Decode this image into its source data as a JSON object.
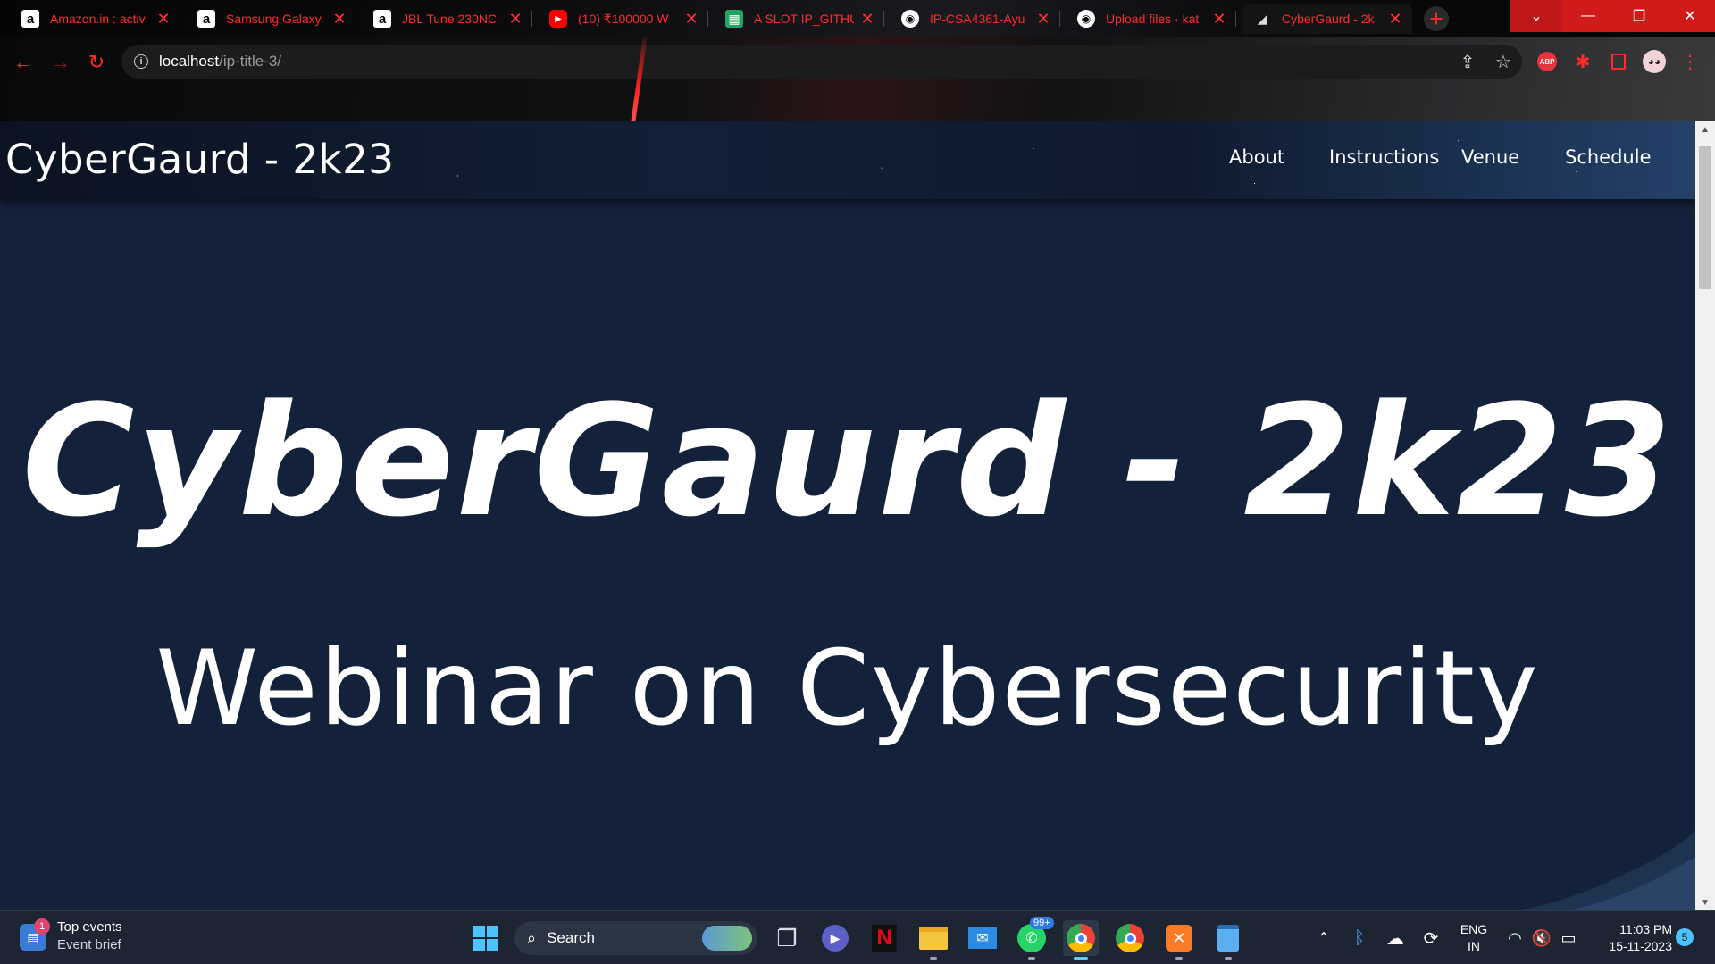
{
  "browser": {
    "tabs": [
      {
        "title": "Amazon.in : activ",
        "favicon": "amazon-icon"
      },
      {
        "title": "Samsung Galaxy",
        "favicon": "amazon-icon"
      },
      {
        "title": "JBL Tune 230NC",
        "favicon": "amazon-icon"
      },
      {
        "title": "(10) ₹100000 W",
        "favicon": "youtube-icon"
      },
      {
        "title": "A SLOT IP_GITHU",
        "favicon": "sheets-icon"
      },
      {
        "title": "IP-CSA4361-Ayu",
        "favicon": "github-icon"
      },
      {
        "title": "Upload files · kat",
        "favicon": "github-icon"
      },
      {
        "title": "CyberGaurd - 2k",
        "favicon": "site-icon"
      }
    ],
    "new_tab": "+",
    "url_host": "localhost",
    "url_path": "/ip-title-3/",
    "extensions": {
      "adblock": "ABP"
    }
  },
  "site": {
    "brand": "CyberGaurd - 2k23",
    "nav": [
      "About",
      "Instructions",
      "Venue",
      "Schedule"
    ],
    "hero_title": "CyberGaurd - 2k23",
    "hero_subtitle": "Webinar on Cybersecurity"
  },
  "taskbar": {
    "widget_title": "Top events",
    "widget_sub": "Event brief",
    "widget_badge": "1",
    "search": "Search",
    "whatsapp_badge": "99+",
    "lang_top": "ENG",
    "lang_bottom": "IN",
    "time": "11:03 PM",
    "date": "15-11-2023",
    "notif_count": "5"
  }
}
